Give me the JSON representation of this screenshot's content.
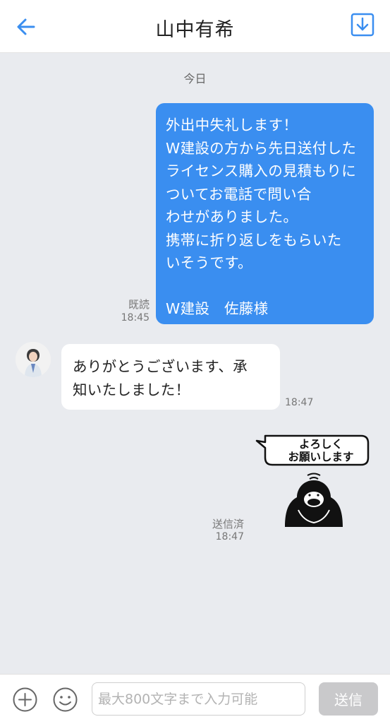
{
  "header": {
    "title": "山中有希",
    "back_icon": "back-arrow-icon",
    "download_icon": "download-icon"
  },
  "chat": {
    "date_separator": "今日",
    "messages": [
      {
        "direction": "outgoing",
        "text": "外出中失礼します！\nW建設の方から先日送付した\nライセンス購入の見積もりについてお電話で問い合\nわせがありました。\n携帯に折り返しをもらいた\nいそうです。\n\nW建設　佐藤様",
        "status": "既読",
        "time": "18:45"
      },
      {
        "direction": "incoming",
        "text": "ありがとうございます、承\n知いたしました！",
        "time": "18:47"
      },
      {
        "direction": "outgoing",
        "type": "sticker",
        "sticker_text": "よろしく\nお願いします",
        "status": "送信済",
        "time": "18:47"
      }
    ]
  },
  "input": {
    "placeholder": "最大800文字まで入力可能",
    "send_label": "送信"
  },
  "colors": {
    "accent": "#3a8ef0",
    "background": "#e9ebef",
    "send_disabled": "#c9c9cb"
  }
}
